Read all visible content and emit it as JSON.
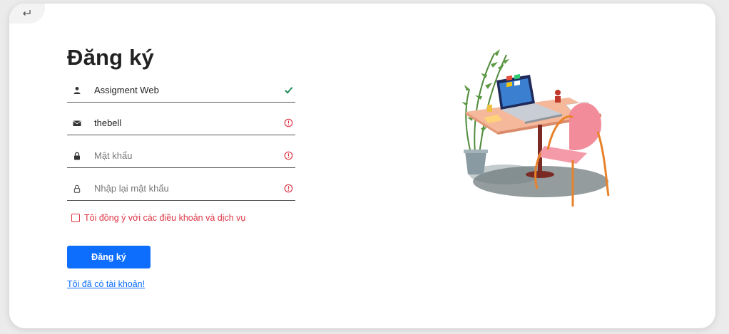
{
  "form": {
    "title": "Đăng ký",
    "fields": [
      {
        "name": "username",
        "icon": "user-icon",
        "value": "Assigment Web",
        "placeholder": "",
        "status": "valid",
        "status_icon": "check-icon"
      },
      {
        "name": "email",
        "icon": "envelope-icon",
        "value": "thebell",
        "placeholder": "",
        "status": "invalid",
        "status_icon": "error-icon"
      },
      {
        "name": "password",
        "icon": "lock-icon",
        "value": "",
        "placeholder": "Mật khẩu",
        "status": "invalid",
        "status_icon": "error-icon"
      },
      {
        "name": "confirm_password",
        "icon": "lock-open-icon",
        "value": "",
        "placeholder": "Nhập lại mật khẩu",
        "status": "invalid",
        "status_icon": "error-icon"
      }
    ],
    "terms_label": "Tôi đồng ý với các điều khoản và dịch vụ",
    "terms_checked": false,
    "submit_label": "Đăng ký",
    "login_link": "Tôi đã có tài khoản!"
  },
  "header": {
    "back_icon": "return-arrow-icon"
  },
  "illustration": {
    "name": "desk-illustration"
  },
  "colors": {
    "primary": "#0d6efd",
    "valid": "#198754",
    "invalid": "#dc3545",
    "background": "#ebebeb",
    "card": "#ffffff"
  }
}
